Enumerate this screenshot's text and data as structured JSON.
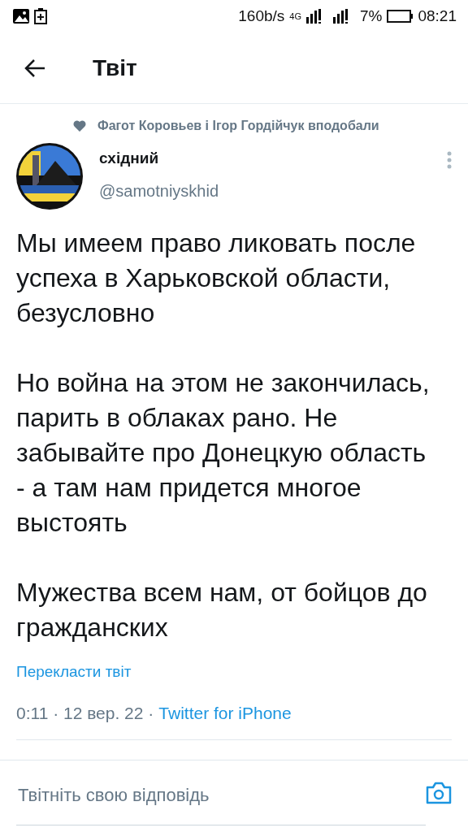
{
  "status_bar": {
    "speed": "160b/s",
    "network": "4G",
    "battery": "7%",
    "time": "08:21"
  },
  "header": {
    "title": "Твіт"
  },
  "social_context": "Фагот Коровьев і Ігор Гордійчук вподобали",
  "author": {
    "name": "східний",
    "handle": "@samotniyskhid"
  },
  "paragraphs": [
    "Мы имеем право ликовать после успеха в Харьковской области, безусловно",
    "Но война на этом не закончилась, парить в облаках рано. Не забывайте про Донецкую область - а там нам придется многое выстоять",
    "Мужества всем нам, от бойцов до гражданских"
  ],
  "translate": "Перекласти твіт",
  "meta": {
    "time": "0:11 · 12 вер. 22 ·",
    "source": "Twitter for iPhone"
  },
  "reply": {
    "placeholder": "Твітніть свою відповідь"
  }
}
